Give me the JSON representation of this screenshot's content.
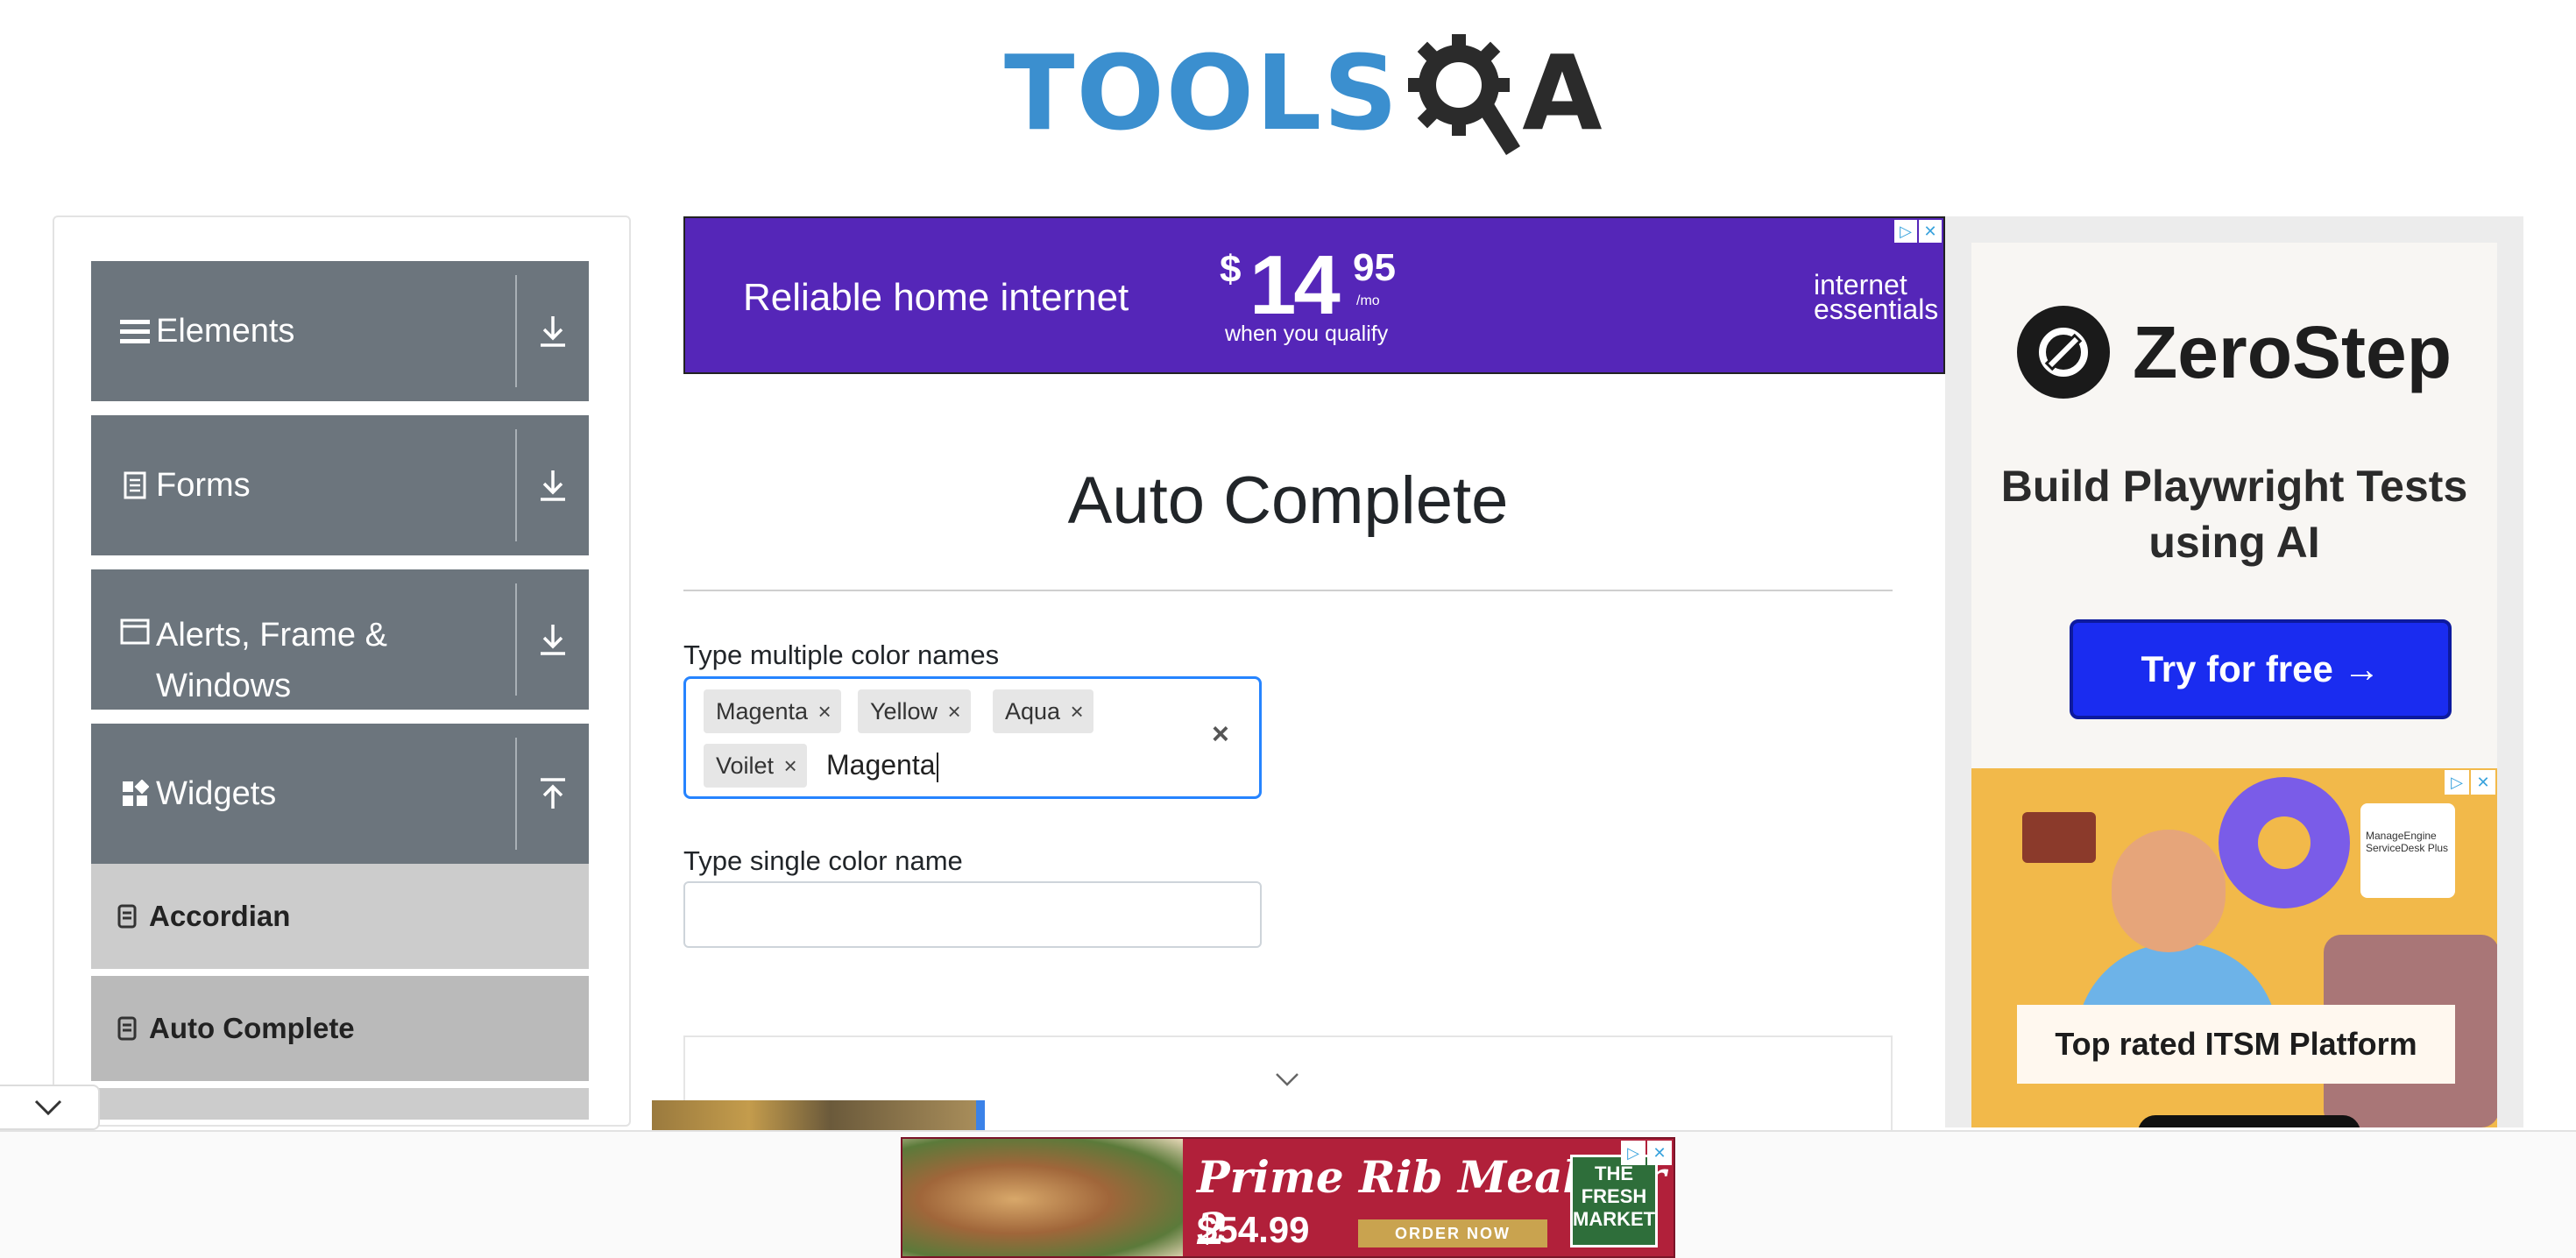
{
  "header": {
    "logo_tools": "TOOLS",
    "logo_qa_a": "A"
  },
  "sidebar": {
    "groups": [
      {
        "label": "Elements",
        "icon": "hamburger-icon",
        "arrow": "download-icon"
      },
      {
        "label": "Forms",
        "icon": "document-icon",
        "arrow": "download-icon"
      },
      {
        "label": "Alerts, Frame & Windows",
        "icon": "window-icon",
        "arrow": "download-icon"
      },
      {
        "label": "Widgets",
        "icon": "widgets-icon",
        "arrow": "upload-icon"
      }
    ],
    "items": [
      {
        "label": "Accordian",
        "active": false
      },
      {
        "label": "Auto Complete",
        "active": true
      }
    ]
  },
  "top_ad": {
    "headline": "Reliable home internet",
    "dollar": "$",
    "price": "14",
    "cents": "95",
    "per": "/mo",
    "qualify": "when you qualify",
    "brand_line1": "internet",
    "brand_line2": "essentials"
  },
  "main": {
    "title": "Auto Complete",
    "multi_label": "Type multiple color names",
    "chips": [
      "Magenta",
      "Yellow",
      "Aqua",
      "Voilet"
    ],
    "typed_value": "Magenta",
    "clear_symbol": "×",
    "chip_remove_symbol": "×",
    "single_label": "Type single color name",
    "single_value": ""
  },
  "right_ad": {
    "brand": "ZeroStep",
    "headline": "Build Playwright Tests using AI",
    "cta": "Try for free →",
    "itsm_card": "ManageEngine ServiceDesk Plus",
    "itsm_label": "Top rated ITSM Platform"
  },
  "bottom_ad": {
    "headline": "Prime Rib Meal for 2",
    "price": "$54.99",
    "order": "ORDER NOW",
    "fresh": "THE FRESH MARKET"
  },
  "colors": {
    "sidebar_group": "#6c757d",
    "sidebar_item": "#cccccc",
    "focus_border": "#2684ff",
    "top_ad_bg": "#5526b8",
    "cta_bg": "#1a2cf0",
    "logo_blue": "#3b8fcf"
  }
}
